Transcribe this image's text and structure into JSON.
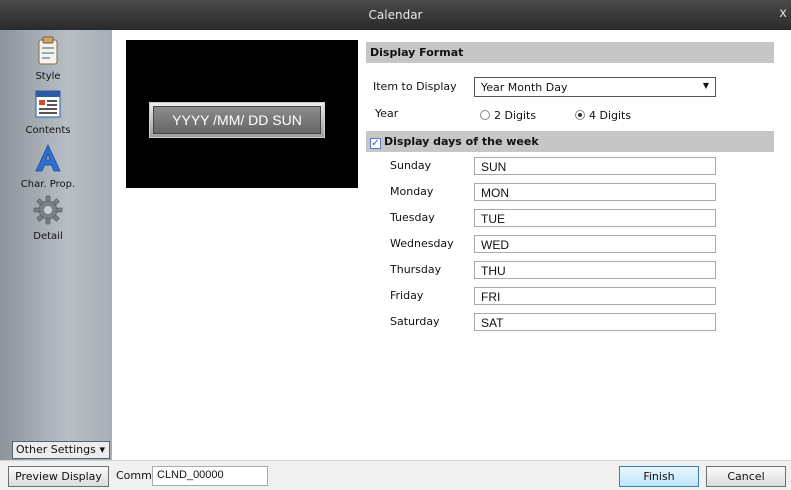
{
  "window": {
    "title": "Calendar",
    "close": "x"
  },
  "sidebar": {
    "items": [
      {
        "label": "Style",
        "icon": "clipboard-icon"
      },
      {
        "label": "Contents",
        "icon": "contents-icon"
      },
      {
        "label": "Char. Prop.",
        "icon": "font-a-icon"
      },
      {
        "label": "Detail",
        "icon": "gear-icon"
      }
    ],
    "other_settings": "Other Settings"
  },
  "preview": {
    "text": "YYYY /MM/ DD SUN"
  },
  "display_format": {
    "heading": "Display Format",
    "item_label": "Item to Display",
    "item_value": "Year Month Day",
    "year_label": "Year",
    "year_options": [
      "2 Digits",
      "4 Digits"
    ],
    "year_selected": "4 Digits"
  },
  "days": {
    "heading": "Display days of the week",
    "checked": true,
    "rows": [
      {
        "label": "Sunday",
        "value": "SUN"
      },
      {
        "label": "Monday",
        "value": "MON"
      },
      {
        "label": "Tuesday",
        "value": "TUE"
      },
      {
        "label": "Wednesday",
        "value": "WED"
      },
      {
        "label": "Thursday",
        "value": "THU"
      },
      {
        "label": "Friday",
        "value": "FRI"
      },
      {
        "label": "Saturday",
        "value": "SAT"
      }
    ]
  },
  "footer": {
    "preview_display": "Preview Display",
    "comm_label": "Comm",
    "comm_value": "CLND_00000",
    "finish": "Finish",
    "cancel": "Cancel"
  }
}
